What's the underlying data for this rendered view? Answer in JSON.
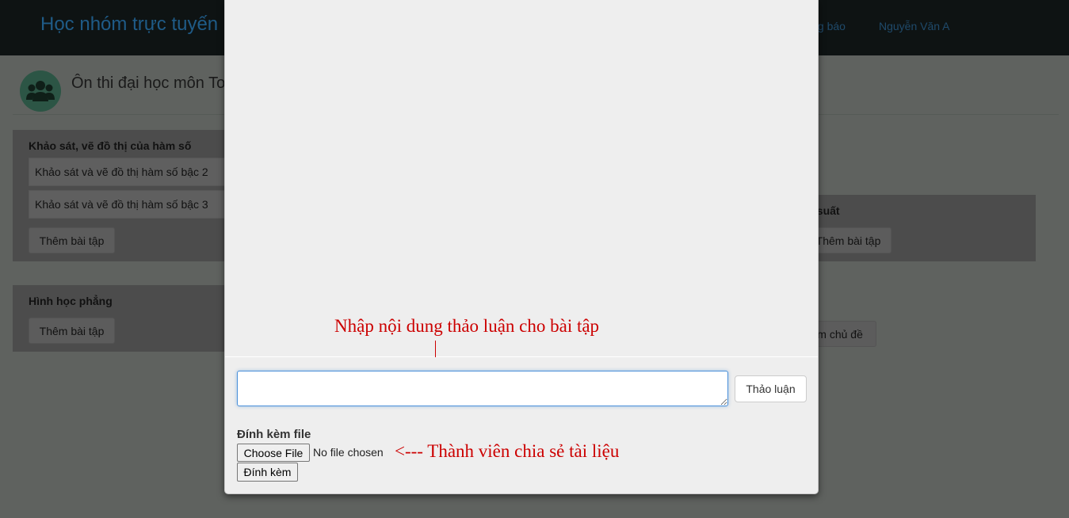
{
  "navbar": {
    "brand": "Học nhóm trực tuyến",
    "notifications_label": "Thông báo",
    "user_name": "Nguyễn Văn A"
  },
  "group": {
    "title": "Ôn thi đại học môn Toán",
    "avatar_icon": "users-icon"
  },
  "topics": [
    {
      "title": "Khảo sát, vẽ đồ thị của hàm số",
      "exercises": [
        "Khảo sát và vẽ đồ thị hàm số bậc 2",
        "Khảo sát và vẽ đồ thị hàm số bậc 3"
      ],
      "add_label": "Thêm bài tập"
    },
    {
      "title": "Hình học phẳng",
      "exercises": [],
      "add_label": "Thêm bài tập"
    },
    {
      "title": "Xác suất",
      "exercises": [],
      "add_label": "Thêm bài tập"
    }
  ],
  "add_topic_label": "Thêm chủ đề",
  "modal": {
    "annotation_discussion": "Nhập nội dung thảo luận cho bài tập",
    "discussion_input_value": "",
    "discuss_button": "Thảo luận",
    "attach_label": "Đính kèm file",
    "choose_file_button": "Choose File",
    "file_status": "No file chosen",
    "annotation_share": "<--- Thành viên chia sẻ tài liệu",
    "attach_button": "Đính kèm"
  },
  "colors": {
    "annotation": "#cc0000",
    "input_focus": "#4a90d9",
    "overlay_bg": "#5f625f"
  }
}
